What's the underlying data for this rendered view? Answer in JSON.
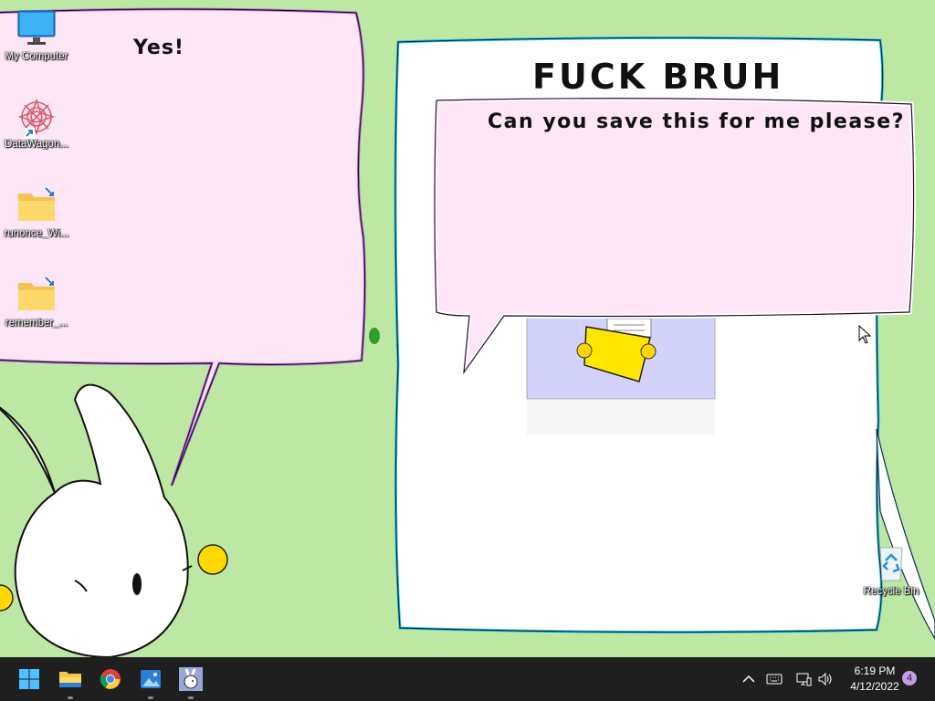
{
  "desktop": {
    "icons": [
      {
        "label": "My Computer",
        "icon": "monitor-icon"
      },
      {
        "label": "DataWagon...",
        "icon": "mandala-shortcut-icon"
      },
      {
        "label": "runonce_Wi...",
        "icon": "folder-shortcut-icon"
      },
      {
        "label": "remember_...",
        "icon": "folder-shortcut-icon"
      },
      {
        "label": "Recycle Bin",
        "icon": "recycle-bin-icon"
      }
    ]
  },
  "wallpaper": {
    "left_bubble_text": "Yes!",
    "right_panel_title": "FUCK BRUH",
    "right_bubble_text": "Can you save this for me please?",
    "background_color": "#bde8a4",
    "bubble_color": "#fde6f6"
  },
  "taskbar": {
    "apps": [
      {
        "name": "start",
        "icon": "windows-start-icon"
      },
      {
        "name": "file-explorer",
        "icon": "folder-icon"
      },
      {
        "name": "chrome",
        "icon": "chrome-icon"
      },
      {
        "name": "photos",
        "icon": "photos-icon"
      },
      {
        "name": "bunny-app",
        "icon": "bunny-icon"
      }
    ],
    "tray": {
      "chevron": "^",
      "time": "6:19 PM",
      "date": "4/12/2022",
      "notification_count": "4"
    }
  }
}
